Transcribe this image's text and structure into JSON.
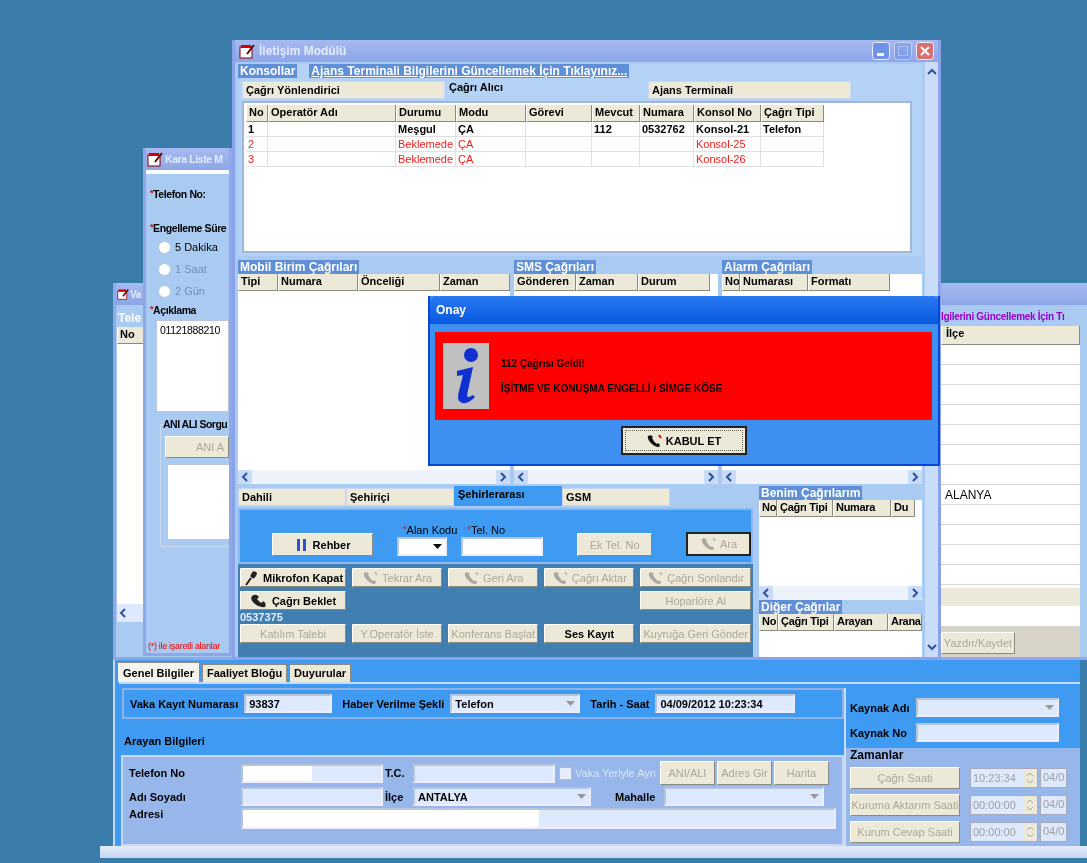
{
  "vaka_window": {
    "title": "Va",
    "group_label": "Tele",
    "table_columns": [
      "No"
    ],
    "link": "lgilerini Güncellemek İçin Tı",
    "ilce_column": "İlçe",
    "ilce_cells": [
      "ALANYA"
    ],
    "print_button": {
      "label": "Yazdır/Kaydet",
      "disabled": true
    }
  },
  "kara_liste_window": {
    "title": "Kara Liste M",
    "phone_label": {
      "mark": "*",
      "text": "Telefon No:"
    },
    "duration_label": {
      "mark": "*",
      "text": "Engelleme Süre"
    },
    "durations": [
      {
        "label": "5 Dakika",
        "selected": false,
        "disabled": false
      },
      {
        "label": "1 Saat",
        "selected": false,
        "disabled": true
      },
      {
        "label": "2 Gün",
        "selected": false,
        "disabled": true
      }
    ],
    "note_label": {
      "mark": "*",
      "text": "Açıklama"
    },
    "note_value": "01121888210",
    "ani_group": "ANI ALI Sorgu",
    "ani_button": {
      "label": "ANI A",
      "disabled": true
    },
    "footnote": "(*) ile işaretli alanlar"
  },
  "iletisim_window": {
    "title": "İletişim Modülü",
    "group_label": "Konsollar",
    "link": "Ajans Terminali Bilgilerini Güncellemek İçin Tıklayınız...",
    "tabs": [
      {
        "label": "Çağrı Yönlendirici",
        "selected": false
      },
      {
        "label": "Çağrı Alıcı",
        "selected": true
      },
      {
        "label": "Ajans Terminali",
        "selected": false
      }
    ],
    "console_table": {
      "columns": [
        "No",
        "Operatör Adı",
        "Durumu",
        "Modu",
        "Görevi",
        "Mevcut",
        "Numara",
        "Konsol No",
        "Çağrı Tipi"
      ],
      "rows": [
        {
          "cells": [
            "1",
            null,
            "Meşgul",
            "ÇA",
            null,
            "112",
            "0532762",
            "Konsol-21",
            "Telefon"
          ],
          "waiting": false
        },
        {
          "cells": [
            "2",
            null,
            "Beklemede",
            "ÇA",
            null,
            null,
            null,
            "Konsol-25",
            null
          ],
          "waiting": true
        },
        {
          "cells": [
            "3",
            null,
            "Beklemede",
            "ÇA",
            null,
            null,
            null,
            "Konsol-26",
            null
          ],
          "waiting": true
        }
      ]
    },
    "panels": [
      {
        "title": "Mobil Birim Çağrıları",
        "columns": [
          "Tipi",
          "Numara",
          "Önceliği",
          "Zaman"
        ]
      },
      {
        "title": "SMS Çağrıları",
        "columns": [
          "Gönderen",
          "Zaman",
          "Durum"
        ]
      },
      {
        "title": "Alarm Çağrıları",
        "columns": [
          "No",
          "Numarası",
          "Formatı"
        ]
      }
    ],
    "dial_tabs": [
      {
        "label": "Dahili",
        "selected": false
      },
      {
        "label": "Şehiriçi",
        "selected": false
      },
      {
        "label": "Şehirlerarası",
        "selected": true
      },
      {
        "label": "GSM",
        "selected": false
      }
    ],
    "rehber_button": {
      "label": "Rehber",
      "disabled": false
    },
    "area_code": {
      "mark": "*",
      "label": "Alan Kodu"
    },
    "tel_no": {
      "mark": "*",
      "label": "Tel. No"
    },
    "ext_button": {
      "label": "Ek Tel. No",
      "disabled": true
    },
    "call_button": {
      "label": "Ara",
      "disabled": true
    },
    "call_buttons": [
      {
        "label": "Mikrofon Kapat",
        "kind": "mic",
        "disabled": false
      },
      {
        "label": "Tekrar Ara",
        "kind": "phone",
        "disabled": true
      },
      {
        "label": "Geri Ara",
        "kind": "phone",
        "disabled": true
      },
      {
        "label": "Çağrı Aktar",
        "kind": "phone",
        "disabled": true
      },
      {
        "label": "Çağrı Sonlandır",
        "kind": "phone",
        "disabled": true
      }
    ],
    "hold_button": {
      "label": "Çağrı Beklet",
      "disabled": false
    },
    "speaker_button": {
      "label": "Hoparlöre Al",
      "disabled": true
    },
    "active_number": "0537375",
    "bottom_buttons": [
      {
        "label": "Katılım Talebi",
        "disabled": true
      },
      {
        "label": "Y.Operatör İste",
        "disabled": true
      },
      {
        "label": "Konferans Başlat",
        "disabled": true
      },
      {
        "label": "Ses Kayıt",
        "disabled": false
      },
      {
        "label": "Kuyruğa Geri Gönder",
        "disabled": true
      }
    ],
    "my_calls": {
      "title": "Benim Çağrılarım",
      "columns": [
        "No",
        "Çağrı Tipi",
        "Numara",
        "Du"
      ]
    },
    "other_calls": {
      "title": "Diğer Çağrılar",
      "columns": [
        "No",
        "Çağrı Tipi",
        "Arayan",
        "Arana"
      ]
    }
  },
  "dialog": {
    "title": "Onay",
    "message": "112 Çağrısı Geldi!",
    "detail": "İŞİTME VE KONUŞMA ENGELLİ / SİMGE KÖSE",
    "button": {
      "label": "KABUL ET",
      "disabled": false
    }
  },
  "main_form": {
    "tabs": [
      {
        "label": "Genel Bilgiler",
        "selected": true
      },
      {
        "label": "Faaliyet Bloğu",
        "selected": false
      },
      {
        "label": "Duyurular",
        "selected": false
      }
    ],
    "case_no": {
      "label": "Vaka Kayıt Numarası",
      "value": "93837"
    },
    "report_method": {
      "label": "Haber Verilme Şekli",
      "value": "Telefon"
    },
    "datetime": {
      "label": "Tarih - Saat",
      "value": "04/09/2012 10:23:34"
    },
    "caller_section": "Arayan Bilgileri",
    "phone": {
      "label": "Telefon No"
    },
    "tc": {
      "label": "T.C."
    },
    "same_location": {
      "label": "Vaka Yeriyle Ayn",
      "checked": false,
      "disabled": true
    },
    "caller_buttons": [
      {
        "label": "ANI/ALI",
        "disabled": true
      },
      {
        "label": "Adres Gir",
        "disabled": true
      },
      {
        "label": "Harita",
        "disabled": true
      }
    ],
    "name": {
      "label": "Adı Soyadı"
    },
    "district": {
      "label": "İlçe",
      "value": "ANTALYA"
    },
    "neighborhood": {
      "label": "Mahalle"
    },
    "address": {
      "label": "Adresi"
    },
    "source_name": {
      "label": "Kaynak Adı"
    },
    "source_no": {
      "label": "Kaynak No"
    },
    "times_group": "Zamanlar",
    "times": [
      {
        "button": "Çağrı Saati",
        "time": "10:23:34",
        "date": "04/0",
        "disabled": true
      },
      {
        "button": "Kuruma Aktarım Saati",
        "time": "00:00:00",
        "date": "04/0",
        "disabled": true
      },
      {
        "button": "Kurum Cevap Saati",
        "time": "00:00:00",
        "date": "04/0",
        "disabled": true
      }
    ]
  }
}
